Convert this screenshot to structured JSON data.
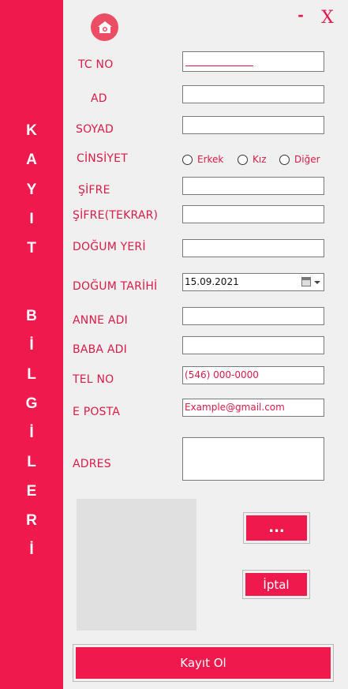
{
  "window": {
    "minimize_label": "-",
    "close_label": "X",
    "home_icon": "home-icon"
  },
  "sidebar": {
    "letters": [
      "K",
      "A",
      "Y",
      "I",
      "T",
      "B",
      "İ",
      "L",
      "G",
      "İ",
      "L",
      "E",
      "R",
      "İ"
    ]
  },
  "form": {
    "tc_no_label": "TC NO",
    "tc_no_value": "",
    "ad_label": "AD",
    "ad_value": "",
    "soyad_label": "SOYAD",
    "soyad_value": "",
    "cinsiyet_label": "CİNSİYET",
    "gender_options": [
      "Erkek",
      "Kız",
      "Diğer"
    ],
    "sifre_label": "ŞİFRE",
    "sifre_value": "",
    "sifre_tekrar_label": "ŞİFRE(TEKRAR)",
    "sifre_tekrar_value": "",
    "dogum_yeri_label": "DOĞUM YERİ",
    "dogum_yeri_value": "",
    "dogum_tarihi_label": "DOĞUM TARİHİ",
    "dogum_tarihi_value": "15.09.2021",
    "anne_adi_label": "ANNE ADI",
    "anne_adi_value": "",
    "baba_adi_label": "BABA ADI",
    "baba_adi_value": "",
    "tel_no_label": "TEL NO",
    "tel_no_value": "(546) 000-0000",
    "e_posta_label": "E POSTA",
    "e_posta_value": "Example@gmail.com",
    "adres_label": "ADRES",
    "adres_value": ""
  },
  "buttons": {
    "browse_label": "...",
    "cancel_label": "İptal",
    "register_label": "Kayıt Ol"
  },
  "colors": {
    "accent": "#f0194d",
    "label_text": "#d81b47",
    "background": "#f0f0f0"
  }
}
